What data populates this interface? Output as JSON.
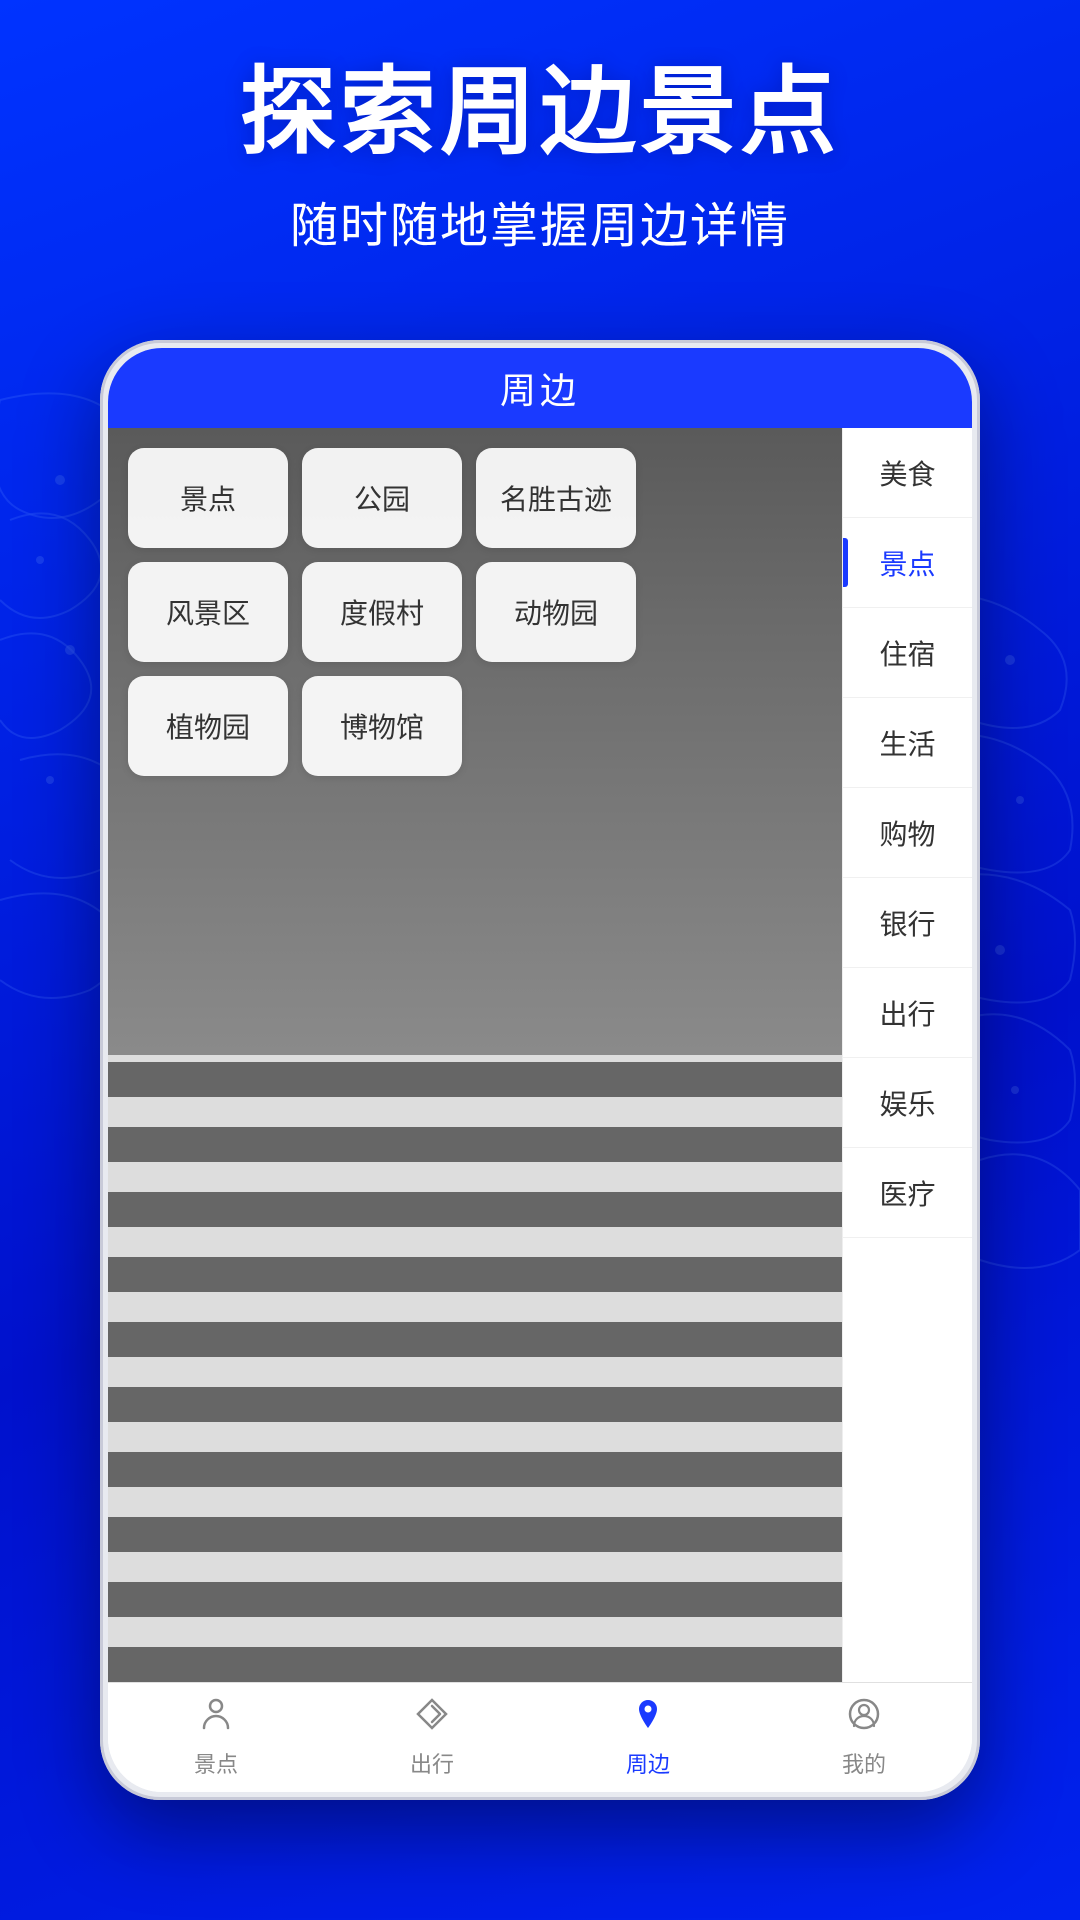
{
  "app": {
    "title": "探索周边景点",
    "subtitle": "随时随地掌握周边详情"
  },
  "header": {
    "title": "周边"
  },
  "categories": {
    "grid": [
      {
        "label": "景点",
        "id": "attractions"
      },
      {
        "label": "公园",
        "id": "parks"
      },
      {
        "label": "名胜古迹",
        "id": "heritage"
      },
      {
        "label": "风景区",
        "id": "scenic"
      },
      {
        "label": "度假村",
        "id": "resort"
      },
      {
        "label": "动物园",
        "id": "zoo"
      },
      {
        "label": "植物园",
        "id": "botanical"
      },
      {
        "label": "博物馆",
        "id": "museum"
      }
    ]
  },
  "sidebar": {
    "items": [
      {
        "label": "美食",
        "id": "food",
        "active": false
      },
      {
        "label": "景点",
        "id": "scenic-side",
        "active": true
      },
      {
        "label": "住宿",
        "id": "hotel",
        "active": false
      },
      {
        "label": "生活",
        "id": "life",
        "active": false
      },
      {
        "label": "购物",
        "id": "shopping",
        "active": false
      },
      {
        "label": "银行",
        "id": "bank",
        "active": false
      },
      {
        "label": "出行",
        "id": "transport",
        "active": false
      },
      {
        "label": "娱乐",
        "id": "entertainment",
        "active": false
      },
      {
        "label": "医疗",
        "id": "medical",
        "active": false
      }
    ]
  },
  "bottom_nav": {
    "items": [
      {
        "label": "景点",
        "id": "nav-attractions",
        "icon": "person",
        "active": false
      },
      {
        "label": "出行",
        "id": "nav-transport",
        "icon": "navigate",
        "active": false
      },
      {
        "label": "周边",
        "id": "nav-nearby",
        "icon": "location",
        "active": true
      },
      {
        "label": "我的",
        "id": "nav-profile",
        "icon": "person-circle",
        "active": false
      }
    ]
  }
}
